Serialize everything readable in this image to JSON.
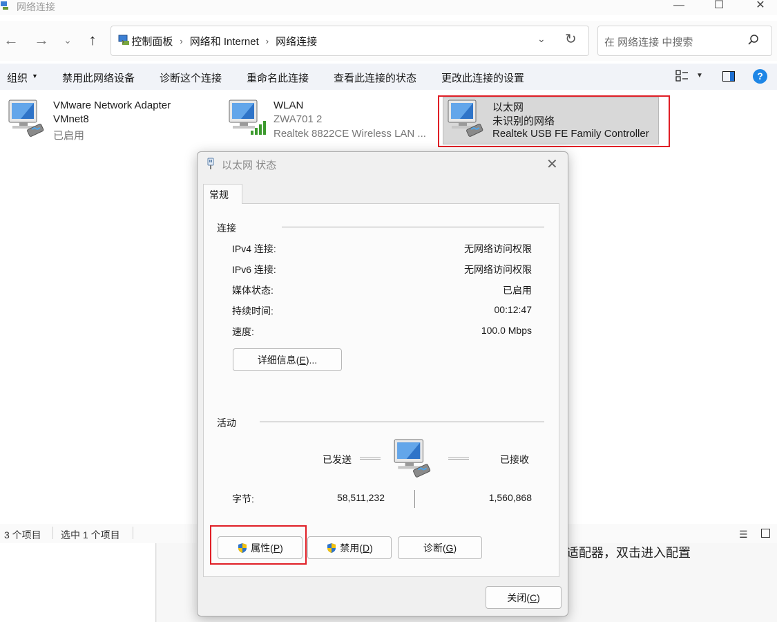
{
  "window": {
    "title": "网络连接",
    "controls": {
      "minimize": "—",
      "maximize": "☐",
      "close": "✕"
    }
  },
  "address_bar": {
    "breadcrumb": [
      "控制面板",
      "网络和 Internet",
      "网络连接"
    ],
    "search_placeholder": "在 网络连接 中搜索"
  },
  "command_bar": {
    "items": [
      "组织",
      "禁用此网络设备",
      "诊断这个连接",
      "重命名此连接",
      "查看此连接的状态",
      "更改此连接的设置"
    ]
  },
  "adapters": [
    {
      "name": "VMware Network Adapter",
      "line2": "VMnet8",
      "line3": "已启用",
      "icon": "network-adapter-icon"
    },
    {
      "name": "WLAN",
      "line2": "ZWA701 2",
      "line3": "Realtek 8822CE Wireless LAN ...",
      "icon": "wifi-adapter-icon"
    },
    {
      "name": "以太网",
      "line2": "未识别的网络",
      "line3": "Realtek USB FE Family Controller",
      "icon": "ethernet-adapter-icon",
      "selected": true
    }
  ],
  "status_bar": {
    "count": "3 个项目",
    "selected": "选中 1 个项目"
  },
  "behind_text": "适配器，双击进入配置",
  "dialog": {
    "title": "以太网 状态",
    "tab": "常规",
    "connection": {
      "label": "连接",
      "rows": [
        {
          "label": "IPv4 连接:",
          "value": "无网络访问权限"
        },
        {
          "label": "IPv6 连接:",
          "value": "无网络访问权限"
        },
        {
          "label": "媒体状态:",
          "value": "已启用"
        },
        {
          "label": "持续时间:",
          "value": "00:12:47"
        },
        {
          "label": "速度:",
          "value": "100.0 Mbps"
        }
      ],
      "details_button": {
        "text": "详细信息(",
        "key": "E",
        "suffix": ")..."
      }
    },
    "activity": {
      "label": "活动",
      "sent_label": "已发送",
      "received_label": "已接收",
      "bytes_label": "字节:",
      "bytes_sent": "58,511,232",
      "bytes_received": "1,560,868"
    },
    "buttons": {
      "properties": {
        "text": "属性(",
        "key": "P",
        "suffix": ")"
      },
      "disable": {
        "text": "禁用(",
        "key": "D",
        "suffix": ")"
      },
      "diagnose": {
        "text": "诊断(",
        "key": "G",
        "suffix": ")"
      },
      "close": {
        "text": "关闭(",
        "key": "C",
        "suffix": ")"
      }
    }
  },
  "colors": {
    "highlight": "#e01f26",
    "selection": "#d8d8d8",
    "accent": "#1e86e6"
  }
}
